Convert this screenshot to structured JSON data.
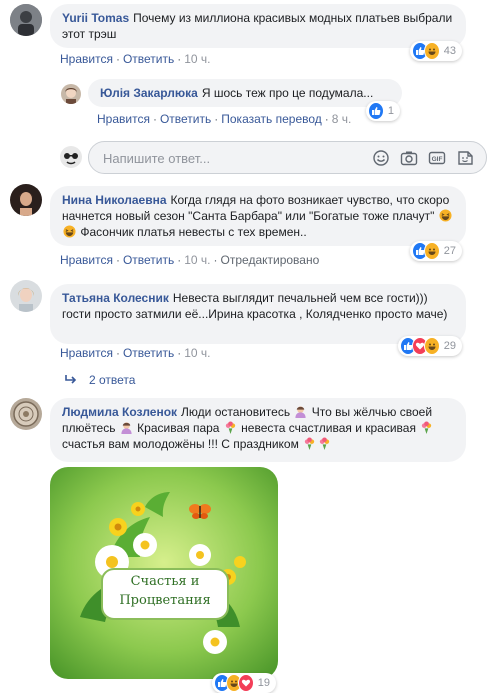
{
  "comments": [
    {
      "author": "Yurii Tomas",
      "text": "Почему из миллиона красивых модных платьев выбрали этот трэш",
      "like": "Нравится",
      "reply": "Ответить",
      "time": "10 ч.",
      "reaction_count": "43"
    },
    {
      "author": "Юлія Закарлюка",
      "text": "Я шось теж про це подумала...",
      "like": "Нравится",
      "reply": "Ответить",
      "show_translation": "Показать перевод",
      "time": "8 ч.",
      "reaction_count": "1"
    },
    {
      "author": "Нина Николаевна",
      "text_part1": "Когда глядя на фото возникает чувство, что скоро начнется новый сезон \"Санта Барбара\" или \"Богатые тоже плачут\"",
      "text_part2": "Фасончик платья невесты с тех времен..",
      "like": "Нравится",
      "reply": "Ответить",
      "time": "10 ч.",
      "edited": "Отредактировано",
      "reaction_count": "27"
    },
    {
      "author": "Татьяна Колесник",
      "text": "Невеста выглядит печальней чем все гости))) гости просто затмили её...Ирина красотка , Колядченко просто маче)",
      "like": "Нравится",
      "reply": "Ответить",
      "time": "10 ч.",
      "reaction_count": "29"
    },
    {
      "author": "Людмила Козленок",
      "text_part1": "Люди остановитесь",
      "text_part2": "Что вы жёлчью своей плюётесь",
      "text_part3": "Красивая пара",
      "text_part4": "невеста счастливая и красивая",
      "text_part5": "счастья вам молодожёны !!! С праздником",
      "reaction_count": "19"
    }
  ],
  "reply_box": {
    "placeholder": "Напишите ответ..."
  },
  "replies_toggle": {
    "label": "2 ответа"
  },
  "card": {
    "line1": "Счастья и",
    "line2": "Процветания"
  },
  "colors": {
    "link": "#385898",
    "bubble": "#f2f3f5",
    "meta": "#90949c",
    "like_blue": "#2078f4",
    "haha_yellow": "#f7b125",
    "love_red": "#f33e58",
    "card_green": "#7cc04a"
  },
  "icons": [
    "like-icon",
    "haha-icon",
    "love-icon",
    "smiley-icon",
    "camera-icon",
    "gif-icon",
    "sticker-icon",
    "reply-arrow-icon"
  ]
}
